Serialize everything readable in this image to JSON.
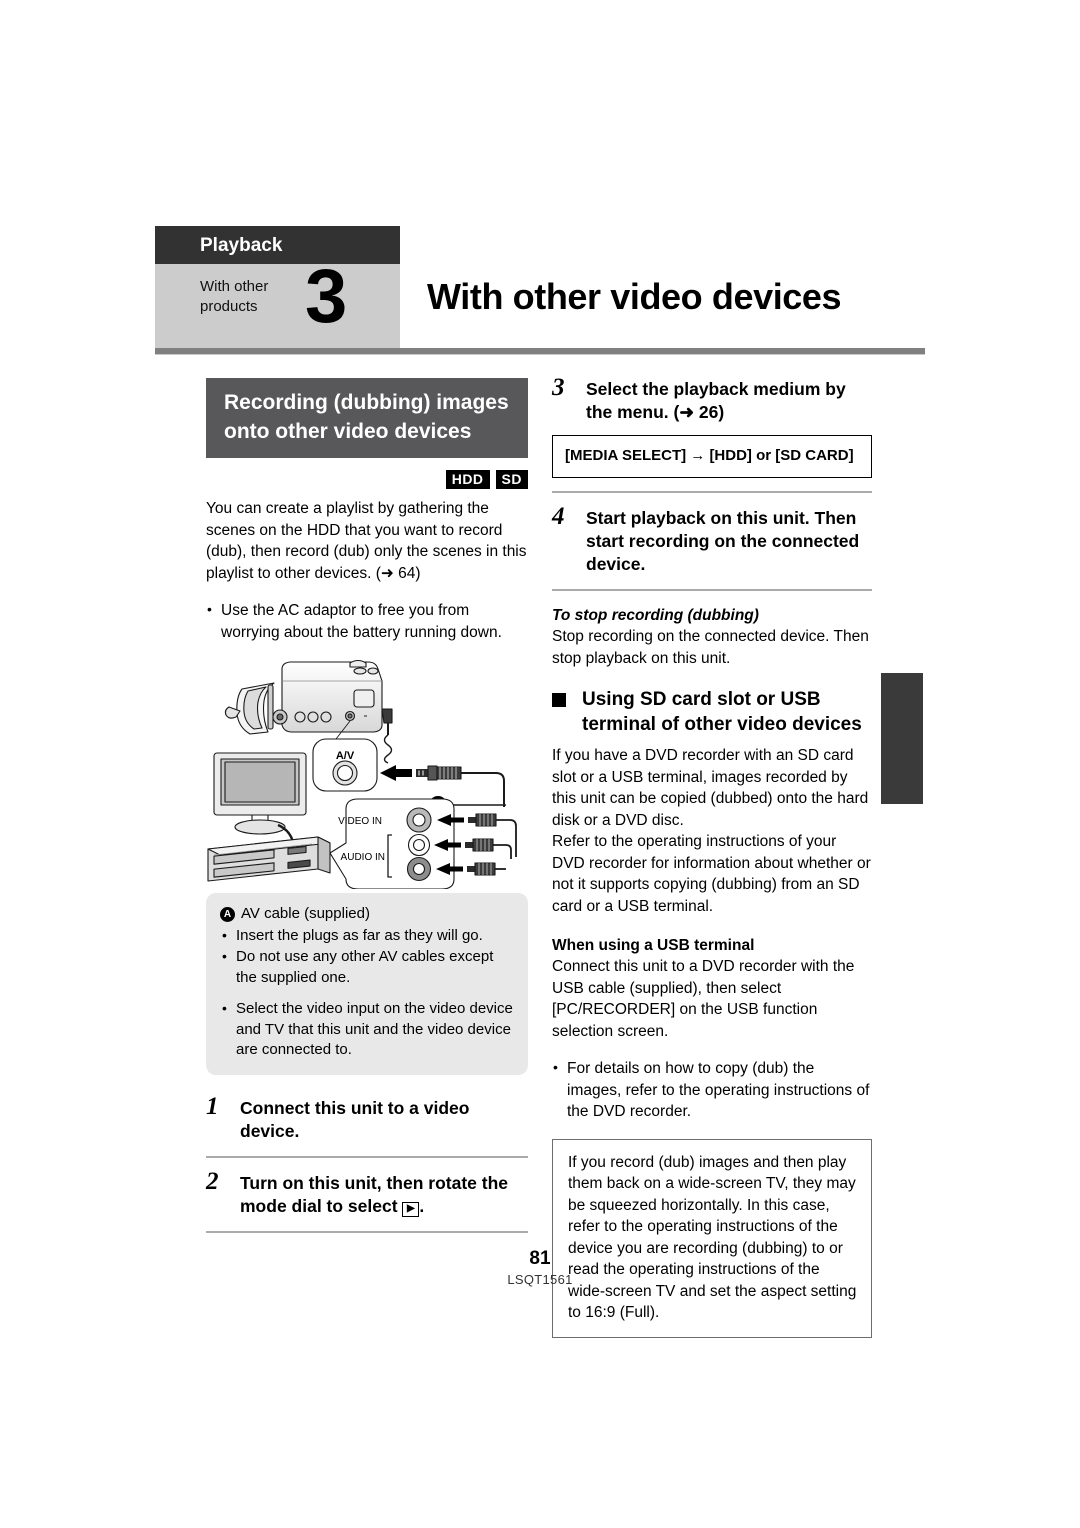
{
  "header": {
    "chapter": "Playback",
    "section_label": "With other\nproducts",
    "section_label_line1": "With other",
    "section_label_line2": "products",
    "section_number": "3",
    "title": "With other video devices"
  },
  "left_column": {
    "section_heading": "Recording (dubbing) images onto other video devices",
    "media_badges": [
      "HDD",
      "SD"
    ],
    "intro_paragraph": "You can create a playlist by gathering the scenes on the HDD that you want to record (dub), then record (dub) only the scenes in this playlist to other devices. (➜ 64)",
    "bullet": "Use the AC adaptor to free you from worrying about the battery running down.",
    "illustration": {
      "name": "av-cable-connection-diagram",
      "camcorder_port_label": "A/V",
      "video_in_label": "VIDEO IN",
      "audio_in_label": "AUDIO IN",
      "callout_letter": "A"
    },
    "note_box": {
      "callout_letter": "A",
      "callout_text": "AV cable (supplied)",
      "bullets": [
        "Insert the plugs as far as they will go.",
        "Do not use any other AV cables except the supplied one.",
        "Select the video input on the video device and TV that this unit and the video device are connected to."
      ]
    },
    "steps": [
      {
        "number": "1",
        "text": "Connect this unit to a video device."
      },
      {
        "number": "2",
        "text": "Turn on this unit, then rotate the mode dial to select "
      }
    ]
  },
  "right_column": {
    "steps": [
      {
        "number": "3",
        "text": "Select the playback medium by the menu. (➜ 26)"
      },
      {
        "number": "4",
        "text": "Start playback on this unit. Then start recording on the connected device."
      }
    ],
    "menu_box": "[MEDIA SELECT] → [HDD] or [SD CARD]",
    "stop_heading": "To stop recording (dubbing)",
    "stop_text": "Stop recording on the connected device. Then stop playback on this unit.",
    "usb_heading": "Using SD card slot or USB terminal of other video devices",
    "usb_paragraph_1": "If you have a DVD recorder with an SD card slot or a USB terminal, images recorded by this unit can be copied (dubbed) onto the hard disk or a DVD disc.",
    "usb_paragraph_2": "Refer to the operating instructions of your DVD recorder for information about whether or not it supports copying (dubbing) from an SD card or a USB terminal.",
    "usb_subheading": "When using a USB terminal",
    "usb_paragraph_3": "Connect this unit to a DVD recorder with the USB cable (supplied), then select [PC/RECORDER] on the USB function selection screen.",
    "usb_bullet": "For details on how to copy (dub) the images, refer to the operating instructions of the DVD recorder.",
    "info_box": "If you record (dub) images and then play them back on a wide-screen TV, they may be squeezed horizontally. In this case, refer to the operating instructions of the device you are recording (dubbing) to or read the operating instructions of the wide-screen TV and set the aspect setting to 16:9 (Full)."
  },
  "footer": {
    "page_number": "81",
    "doc_code": "LSQT1561"
  },
  "colors": {
    "chapter_bar": "#323232",
    "section_band": "#cccccc",
    "heading_box": "#58585a",
    "rule": "#808080",
    "note_block": "#e8e8e8",
    "side_tab": "#3a3a3a"
  }
}
